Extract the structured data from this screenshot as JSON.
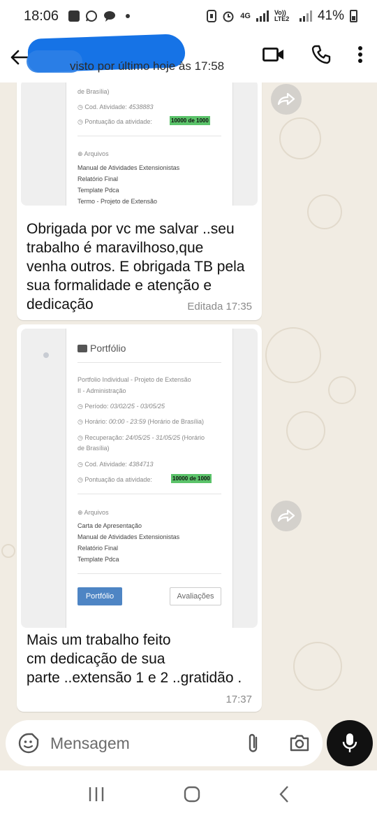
{
  "status_bar": {
    "time": "18:06",
    "network": "4G",
    "volte": "Vo)) LTE2",
    "battery": "41%"
  },
  "header": {
    "last_seen": "visto por último hoje às 17:58"
  },
  "messages": [
    {
      "shot": {
        "location_tail": "de Brasília)",
        "cod_label": "Cod. Atividade:",
        "cod_value": "4538883",
        "score_label": "Pontuação da atividade:",
        "score_value": "10000 de 1000",
        "files_label": "Arquivos",
        "files": [
          "Manual de Atividades Extensionistas",
          "Relatório Final",
          "Template Pdca",
          "Termo - Projeto de Extensão"
        ]
      },
      "text": "Obrigada por vc me salvar ..seu\ntrabalho é maravilhoso,que\nvenha outros. E obrigada TB pela\nsua formalidade e atenção  e\ndedicação",
      "meta": "Editada  17:35"
    },
    {
      "shot": {
        "section_title": "Portfólio",
        "activity_title_1": "Portfolio Individual - Projeto de Extensão",
        "activity_title_2": "II - Administração",
        "period_label": "Período:",
        "period_value": "03/02/25 - 03/05/25",
        "hours_label": "Horário:",
        "hours_value": "00:00 - 23:59",
        "hours_note": "(Horário de Brasília)",
        "recovery_label": "Recuperação:",
        "recovery_value": "24/05/25 - 31/05/25",
        "recovery_note": "(Horário",
        "recovery_note_2": "de Brasília)",
        "cod_label": "Cod. Atividade:",
        "cod_value": "4384713",
        "score_label": "Pontuação da atividade:",
        "score_value": "10000 de 1000",
        "files_label": "Arquivos",
        "files": [
          "Carta de Apresentação",
          "Manual de Atividades Extensionistas",
          "Relatório Final",
          "Template Pdca"
        ],
        "btn_portfolio": "Portfólio",
        "btn_reviews": "Avaliações"
      },
      "text": "Mais um trabalho feito\ncm dedicação de sua\nparte ..extensão 1 e 2 ..gratidão .",
      "meta": "17:37"
    }
  ],
  "input": {
    "placeholder": "Mensagem"
  },
  "colors": {
    "chat_bg": "#f1ece3",
    "bubble": "#ffffff",
    "score_highlight": "#5bc36a",
    "portfolio_button": "#4e85c4"
  }
}
